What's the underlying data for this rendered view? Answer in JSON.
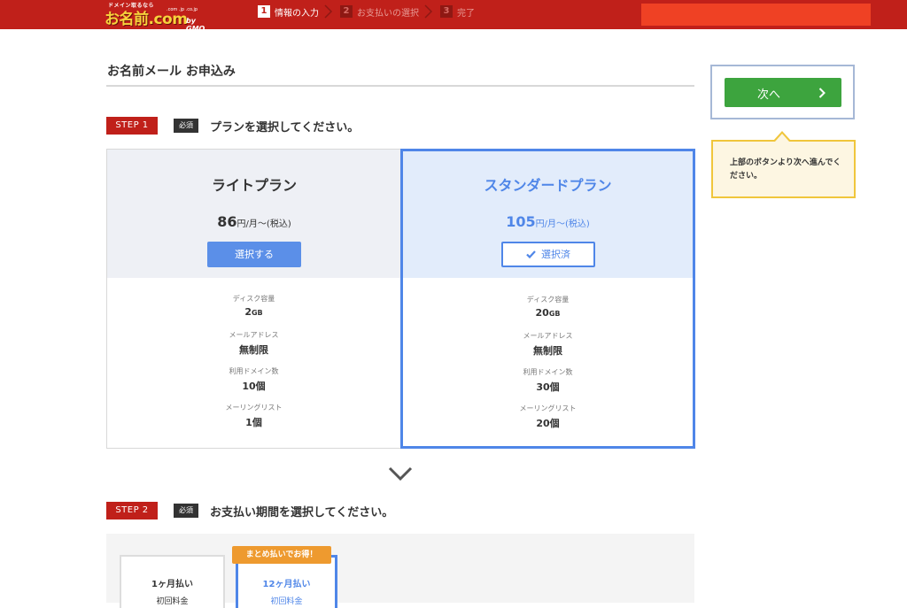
{
  "header": {
    "logo_top": "ドメイン取るなら",
    "logo_main": "お名前.com",
    "logo_tlds": ".com .jp .co.jp",
    "logo_gmo": "by GMO",
    "steps": [
      {
        "num": "1",
        "label": "情報の入力",
        "active": true
      },
      {
        "num": "2",
        "label": "お支払いの選択",
        "active": false
      },
      {
        "num": "3",
        "label": "完了",
        "active": false
      }
    ]
  },
  "page": {
    "title": "お名前メール お申込み"
  },
  "step1": {
    "badge": "STEP 1",
    "required": "必須",
    "title": "プランを選択してください。"
  },
  "plans": [
    {
      "name": "ライトプラン",
      "price": "86",
      "price_unit": "円/月～(税込)",
      "button": "選択する",
      "specs": [
        {
          "label": "ディスク容量",
          "value": "2",
          "unit": "GB"
        },
        {
          "label": "メールアドレス",
          "value": "無制限",
          "unit": ""
        },
        {
          "label": "利用ドメイン数",
          "value": "10個",
          "unit": ""
        },
        {
          "label": "メーリングリスト",
          "value": "1個",
          "unit": ""
        }
      ]
    },
    {
      "name": "スタンダードプラン",
      "price": "105",
      "price_unit": "円/月～(税込)",
      "button": "選択済",
      "specs": [
        {
          "label": "ディスク容量",
          "value": "20",
          "unit": "GB"
        },
        {
          "label": "メールアドレス",
          "value": "無制限",
          "unit": ""
        },
        {
          "label": "利用ドメイン数",
          "value": "30個",
          "unit": ""
        },
        {
          "label": "メーリングリスト",
          "value": "20個",
          "unit": ""
        }
      ]
    }
  ],
  "sidebar": {
    "next_button": "次へ",
    "tip": "上部のボタンより次へ進んでください。"
  },
  "step2": {
    "badge": "STEP 2",
    "required": "必須",
    "title": "お支払い期間を選択してください。",
    "deal_tag": "まとめ払いでお得！",
    "periods": [
      {
        "title": "1ヶ月払い",
        "sub": "初回料金"
      },
      {
        "title": "12ヶ月払い",
        "sub": "初回料金"
      }
    ]
  },
  "colors": {
    "brand_red": "#c0201a",
    "accent_blue": "#4f86e8",
    "next_green": "#3da43e",
    "tip_yellow": "#f0c63c"
  }
}
